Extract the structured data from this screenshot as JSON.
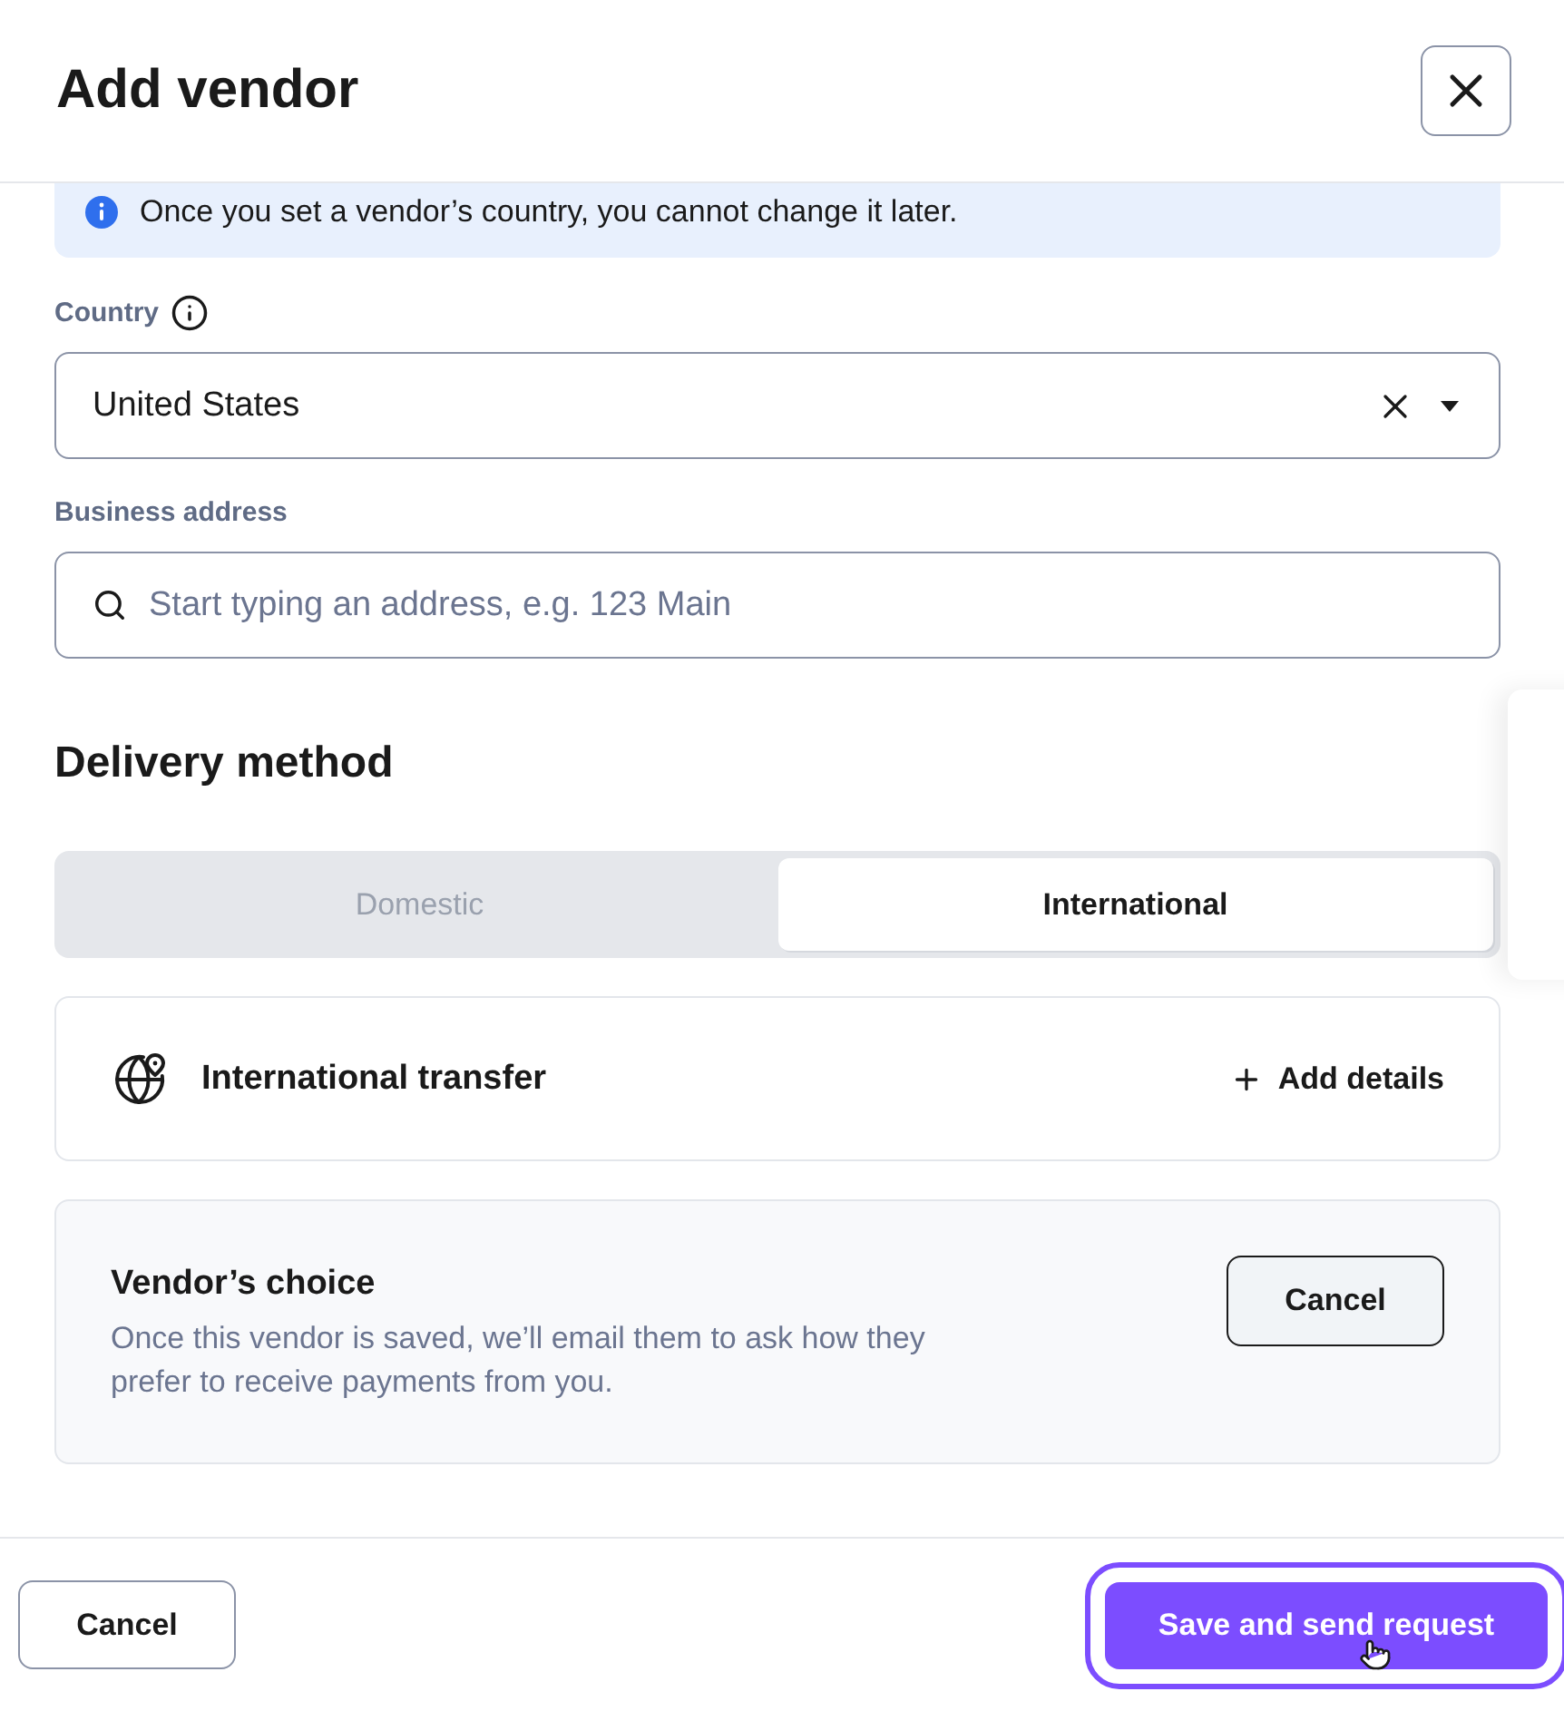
{
  "dialog": {
    "title": "Add vendor"
  },
  "notice": {
    "text": "Once you set a vendor’s country, you cannot change it later."
  },
  "country": {
    "label": "Country",
    "value": "United States"
  },
  "business_address": {
    "label": "Business address",
    "placeholder": "Start typing an address, e.g. 123 Main"
  },
  "delivery": {
    "heading": "Delivery method",
    "tabs": [
      {
        "label": "Domestic",
        "selected": false,
        "disabled": true
      },
      {
        "label": "International",
        "selected": true,
        "disabled": false
      }
    ],
    "methods": [
      {
        "title": "International transfer",
        "action": "Add details"
      }
    ],
    "vendor_choice": {
      "title": "Vendor’s choice",
      "description": "Once this vendor is saved, we’ll email them to ask how they prefer to receive payments from you.",
      "button": "Cancel"
    }
  },
  "footer": {
    "buttons": [
      {
        "label": "Cancel",
        "kind": "secondary"
      },
      {
        "label": "Save and send request",
        "kind": "primary",
        "focused": true
      }
    ]
  }
}
